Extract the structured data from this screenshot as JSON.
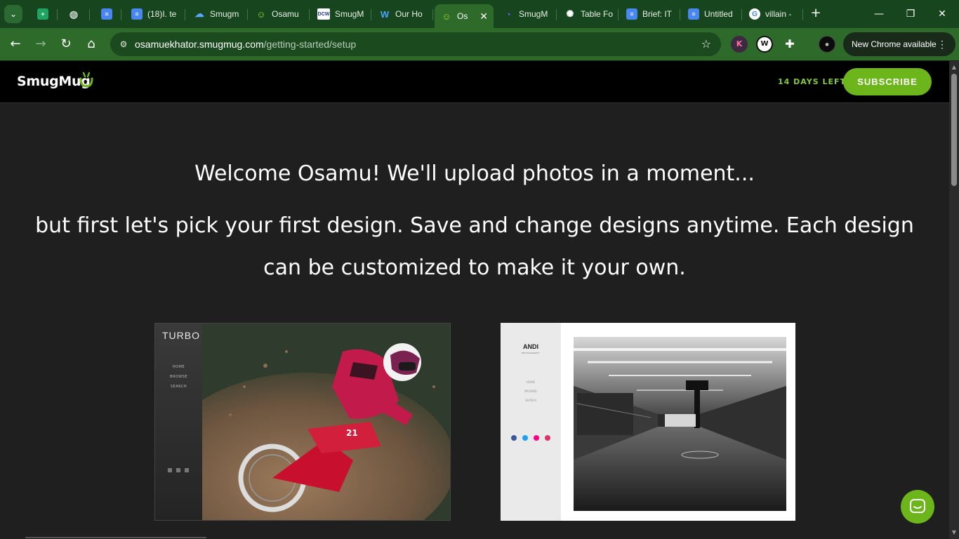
{
  "browser": {
    "tabs": [
      {
        "label": "",
        "icon": "google-sheets-icon"
      },
      {
        "label": "",
        "icon": "globe-icon"
      },
      {
        "label": "",
        "icon": "google-docs-icon"
      },
      {
        "label": "(18)I. te",
        "icon": "google-docs-icon"
      },
      {
        "label": "Smugm",
        "icon": "cloud-icon"
      },
      {
        "label": "Osamu",
        "icon": "smugmug-icon"
      },
      {
        "label": "SmugM",
        "icon": "dcw-icon",
        "icon_text": "DCW"
      },
      {
        "label": "Our Ho",
        "icon": "w-logo-icon",
        "icon_text": "W"
      },
      {
        "label": "Os",
        "icon": "smugmug-icon",
        "active": true
      },
      {
        "label": "SmugM",
        "icon": "swirl-icon"
      },
      {
        "label": "Table Fo",
        "icon": "chatgpt-icon"
      },
      {
        "label": "Brief: IT",
        "icon": "google-docs-icon"
      },
      {
        "label": "Untitled",
        "icon": "google-docs-icon"
      },
      {
        "label": "villain -",
        "icon": "google-icon",
        "icon_text": "G"
      }
    ],
    "url_host": "osamuekhator.smugmug.com",
    "url_path": "/getting-started/setup",
    "extensions": {
      "k_label": "K",
      "w_label": "W"
    },
    "update_label": "New Chrome available"
  },
  "header": {
    "logo_text": "SmugMug",
    "days_left": "14 DAYS LEFT",
    "subscribe_label": "SUBSCRIBE",
    "brand_color": "#6cb51b"
  },
  "welcome": {
    "title": "Welcome Osamu! We'll upload photos in a moment...",
    "subtitle": "but first let's pick your first design. Save and change designs anytime. Each design can be customized to make it your own."
  },
  "designs": [
    {
      "name": "TURBO",
      "nav": [
        "HOME",
        "BROWSE",
        "SEARCH"
      ]
    },
    {
      "name": "ANDI",
      "tagline": "PHOTOGRAPHY",
      "nav": [
        "HOME",
        "BROWSE",
        "SEARCH"
      ]
    }
  ]
}
